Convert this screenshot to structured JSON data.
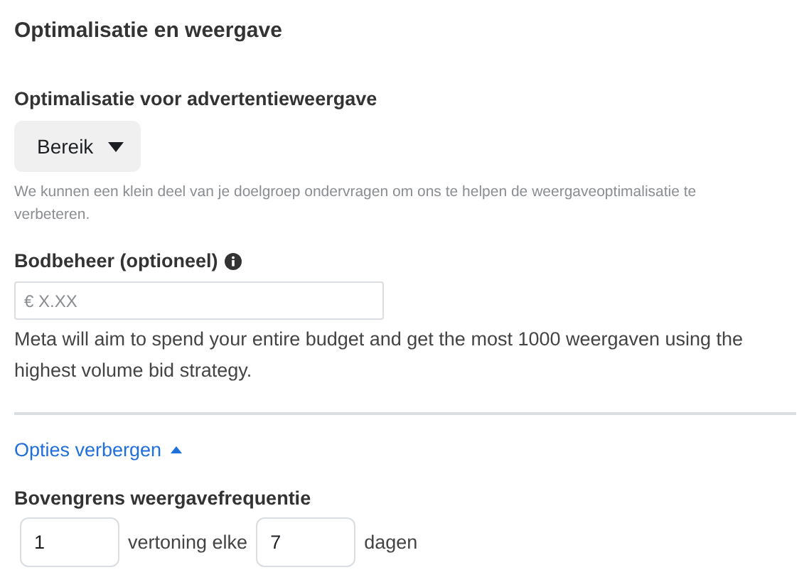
{
  "section_title": "Optimalisatie en weergave",
  "optimization": {
    "label": "Optimalisatie voor advertentieweergave",
    "dropdown": {
      "value": "Bereik"
    },
    "hint": "We kunnen een klein deel van je doelgroep ondervragen om ons te helpen de weergaveoptimalisatie te verbeteren."
  },
  "bid_control": {
    "label": "Bodbeheer (optioneel)",
    "field": {
      "placeholder": "€ X.XX"
    },
    "description": "Meta will aim to spend your entire budget and get the most 1000 weergaven using the highest volume bid strategy."
  },
  "toggle_link": {
    "label": "Opties verbergen",
    "expanded": true
  },
  "frequency_cap": {
    "label": "Bovengrens weergavefrequentie",
    "impressions": {
      "value": "1"
    },
    "middle_text": "vertoning elke",
    "days": {
      "value": "7"
    },
    "unit": "dagen"
  }
}
